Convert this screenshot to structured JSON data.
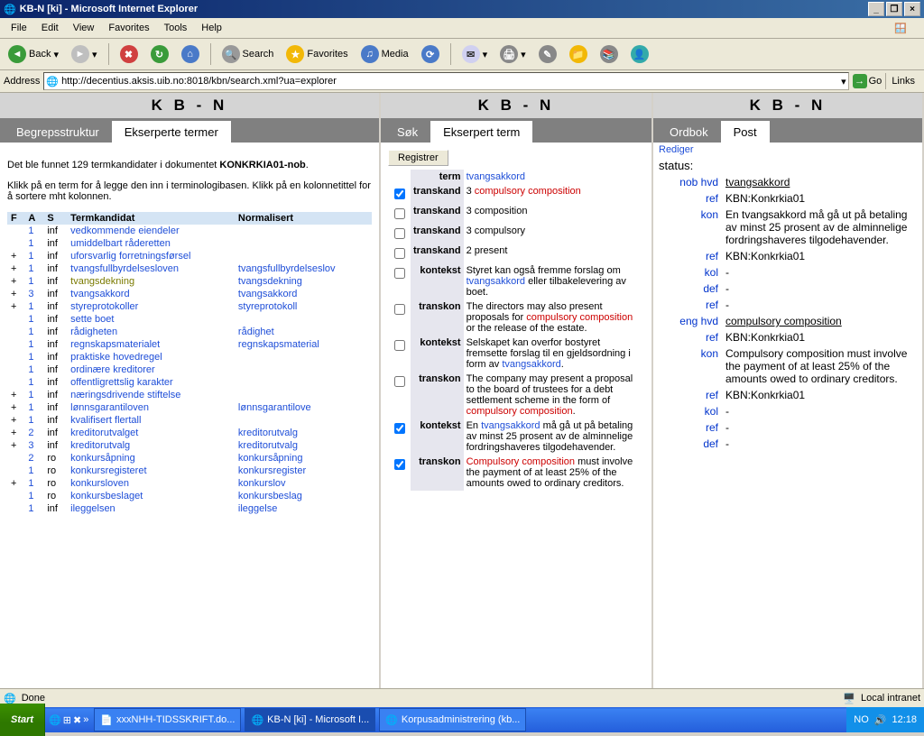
{
  "window": {
    "title": "KB-N [ki] - Microsoft Internet Explorer"
  },
  "menu": {
    "file": "File",
    "edit": "Edit",
    "view": "View",
    "favorites": "Favorites",
    "tools": "Tools",
    "help": "Help"
  },
  "tb": {
    "back": "Back",
    "search": "Search",
    "favorites": "Favorites",
    "media": "Media"
  },
  "addr": {
    "label": "Address",
    "url": "http://decentius.aksis.uib.no:8018/kbn/search.xml?ua=explorer",
    "go": "Go",
    "links": "Links"
  },
  "left": {
    "header": "K B - N",
    "tab1": "Begrepsstruktur",
    "tab2": "Ekserperte termer",
    "info1a": "Det ble funnet 129 termkandidater i dokumentet ",
    "info1b": "KONKRKIA01-nob",
    "info1c": ".",
    "info2": "Klikk på en term for å legge den inn i terminologibasen. Klikk på en kolonnetittel for å sortere mht kolonnen.",
    "cols": {
      "f": "F",
      "a": "A",
      "s": "S",
      "term": "Termkandidat",
      "norm": "Normalisert"
    },
    "rows": [
      {
        "p": "",
        "a": "1",
        "s": "inf",
        "t": "vedkommende eiendeler",
        "n": ""
      },
      {
        "p": "",
        "a": "1",
        "s": "inf",
        "t": "umiddelbart råderetten",
        "n": ""
      },
      {
        "p": "+",
        "a": "1",
        "s": "inf",
        "t": "uforsvarlig forretningsførsel",
        "n": ""
      },
      {
        "p": "+",
        "a": "1",
        "s": "inf",
        "t": "tvangsfullbyrdelsesloven",
        "n": "tvangsfullbyrdelseslov"
      },
      {
        "p": "+",
        "a": "1",
        "s": "inf",
        "t": "tvangsdekning",
        "n": "tvangsdekning",
        "olive": true
      },
      {
        "p": "+",
        "a": "3",
        "s": "inf",
        "t": "tvangsakkord",
        "n": "tvangsakkord"
      },
      {
        "p": "+",
        "a": "1",
        "s": "inf",
        "t": "styreprotokoller",
        "n": "styreprotokoll"
      },
      {
        "p": "",
        "a": "1",
        "s": "inf",
        "t": "sette boet",
        "n": ""
      },
      {
        "p": "",
        "a": "1",
        "s": "inf",
        "t": "rådigheten",
        "n": "rådighet"
      },
      {
        "p": "",
        "a": "1",
        "s": "inf",
        "t": "regnskapsmaterialet",
        "n": "regnskapsmaterial"
      },
      {
        "p": "",
        "a": "1",
        "s": "inf",
        "t": "praktiske hovedregel",
        "n": ""
      },
      {
        "p": "",
        "a": "1",
        "s": "inf",
        "t": "ordinære kreditorer",
        "n": ""
      },
      {
        "p": "",
        "a": "1",
        "s": "inf",
        "t": "offentligrettslig karakter",
        "n": ""
      },
      {
        "p": "+",
        "a": "1",
        "s": "inf",
        "t": "næringsdrivende stiftelse",
        "n": ""
      },
      {
        "p": "+",
        "a": "1",
        "s": "inf",
        "t": "lønnsgarantiloven",
        "n": "lønnsgarantilove"
      },
      {
        "p": "+",
        "a": "1",
        "s": "inf",
        "t": "kvalifisert flertall",
        "n": ""
      },
      {
        "p": "+",
        "a": "2",
        "s": "inf",
        "t": "kreditorutvalget",
        "n": "kreditorutvalg"
      },
      {
        "p": "+",
        "a": "3",
        "s": "inf",
        "t": "kreditorutvalg",
        "n": "kreditorutvalg"
      },
      {
        "p": "",
        "a": "2",
        "s": "ro",
        "t": "konkursåpning",
        "n": "konkursåpning"
      },
      {
        "p": "",
        "a": "1",
        "s": "ro",
        "t": "konkursregisteret",
        "n": "konkursregister"
      },
      {
        "p": "+",
        "a": "1",
        "s": "ro",
        "t": "konkursloven",
        "n": "konkurslov"
      },
      {
        "p": "",
        "a": "1",
        "s": "ro",
        "t": "konkursbeslaget",
        "n": "konkursbeslag"
      },
      {
        "p": "",
        "a": "1",
        "s": "inf",
        "t": "ileggelsen",
        "n": "ileggelse"
      }
    ]
  },
  "mid": {
    "header": "K B - N",
    "tab1": "Søk",
    "tab2": "Ekserpert term",
    "reg": "Registrer",
    "rows": [
      {
        "chk": false,
        "lbl": "term",
        "txt": "tvangsakkord",
        "blue": true
      },
      {
        "chk": true,
        "lbl": "transkand",
        "txt": "3 compulsory composition",
        "red": "compulsory composition",
        "pre": "3 "
      },
      {
        "chk": false,
        "lbl": "transkand",
        "txt": "3 composition"
      },
      {
        "chk": false,
        "lbl": "transkand",
        "txt": "3 compulsory"
      },
      {
        "chk": false,
        "lbl": "transkand",
        "txt": "2 present"
      },
      {
        "chk": false,
        "lbl": "kontekst",
        "txt": "Styret kan også fremme forslag om tvangsakkord eller tilbakelevering av boet.",
        "bluew": "tvangsakkord"
      },
      {
        "chk": false,
        "lbl": "transkon",
        "txt": "The directors may also present proposals for compulsory composition or the release of the estate.",
        "redw": "compulsory composition"
      },
      {
        "chk": false,
        "lbl": "kontekst",
        "txt": "Selskapet kan overfor bostyret fremsette forslag til en gjeldsordning i form av tvangsakkord.",
        "bluew": "tvangsakkord"
      },
      {
        "chk": false,
        "lbl": "transkon",
        "txt": "The company may present a proposal to the board of trustees for a debt settlement scheme in the form of compulsory composition.",
        "redw": "compulsory composition"
      },
      {
        "chk": true,
        "lbl": "kontekst",
        "txt": "En tvangsakkord må gå ut på betaling av minst 25 prosent av de alminnelige fordringshaveres tilgodehavender.",
        "bluew": "tvangsakkord"
      },
      {
        "chk": true,
        "lbl": "transkon",
        "txt": "Compulsory composition must involve the payment of at least 25% of the amounts owed to ordinary creditors.",
        "redw": "Compulsory composition"
      }
    ]
  },
  "right": {
    "header": "K B - N",
    "tab1": "Ordbok",
    "tab2": "Post",
    "rediger": "Rediger",
    "status": "status:",
    "rows": [
      {
        "f": "nob hvd",
        "v": "tvangsakkord",
        "u": true
      },
      {
        "f": "ref",
        "v": "KBN:Konkrkia01"
      },
      {
        "f": "kon",
        "v": "En tvangsakkord må gå ut på betaling av minst 25 prosent av de alminnelige fordringshaveres tilgodehavender."
      },
      {
        "f": "ref",
        "v": "KBN:Konkrkia01"
      },
      {
        "f": "kol",
        "v": "-"
      },
      {
        "f": "def",
        "v": "-"
      },
      {
        "f": "ref",
        "v": "-"
      },
      {
        "f": "eng hvd",
        "v": "compulsory composition",
        "u": true
      },
      {
        "f": "ref",
        "v": "KBN:Konkrkia01"
      },
      {
        "f": "kon",
        "v": "Compulsory composition must involve the payment of at least 25% of the amounts owed to ordinary creditors."
      },
      {
        "f": "ref",
        "v": "KBN:Konkrkia01"
      },
      {
        "f": "kol",
        "v": "-"
      },
      {
        "f": "ref",
        "v": "-"
      },
      {
        "f": "def",
        "v": "-"
      }
    ]
  },
  "status": {
    "done": "Done",
    "intranet": "Local intranet"
  },
  "taskbar": {
    "start": "Start",
    "t1": "xxxNHH-TIDSSKRIFT.do...",
    "t2": "KB-N [ki] - Microsoft I...",
    "t3": "Korpusadministrering (kb...",
    "time": "12:18"
  }
}
